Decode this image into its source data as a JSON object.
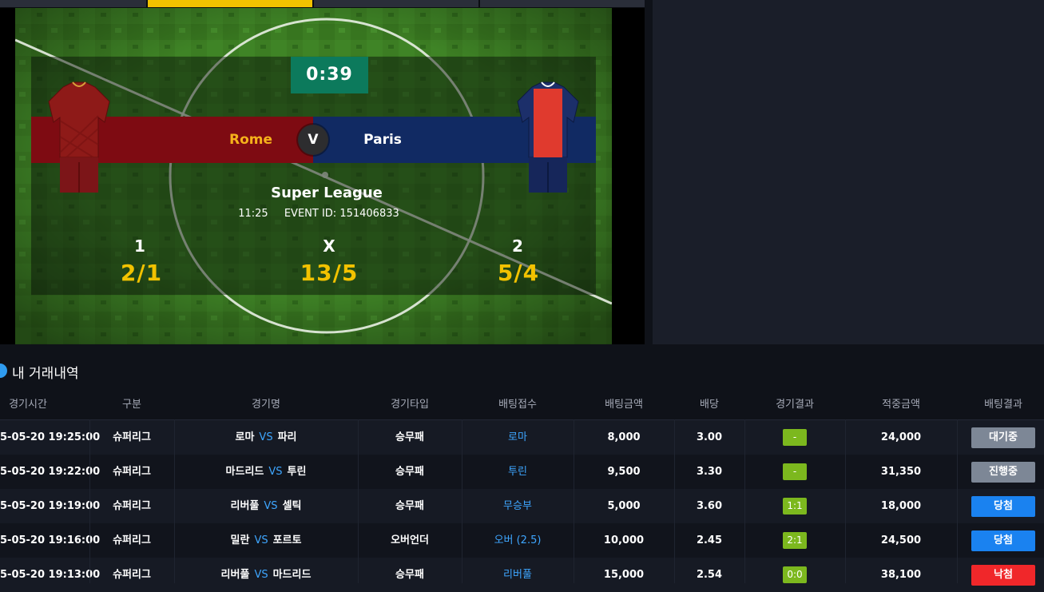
{
  "match": {
    "timer": "0:39",
    "home_team": "Rome",
    "away_team": "Paris",
    "vs": "V",
    "league": "Super League",
    "time": "11:25",
    "event_id": "EVENT ID:  151406833",
    "odds": [
      {
        "label": "1",
        "value": "2/1"
      },
      {
        "label": "X",
        "value": "13/5"
      },
      {
        "label": "2",
        "value": "5/4"
      }
    ],
    "colors": {
      "home": "#7e0b12",
      "away": "#112a63",
      "odds": "#f2c200",
      "timer": "#0c7a5c"
    }
  },
  "history": {
    "title": "내 거래내역",
    "columns": [
      "경기시간",
      "구분",
      "경기명",
      "경기타입",
      "배팅접수",
      "배팅금액",
      "배당",
      "경기결과",
      "적중금액",
      "배팅결과"
    ],
    "rows": [
      {
        "time": "5-05-20 19:25:00",
        "category": "슈퍼리그",
        "home": "로마",
        "away": "파리",
        "vs": "VS",
        "type": "승무패",
        "pick": "로마",
        "amount": "8,000",
        "odds": "3.00",
        "result": "-",
        "payout": "24,000",
        "status": "대기중",
        "status_color": "#7d8796"
      },
      {
        "time": "5-05-20 19:22:00",
        "category": "슈퍼리그",
        "home": "마드리드",
        "away": "투린",
        "vs": "VS",
        "type": "승무패",
        "pick": "투린",
        "amount": "9,500",
        "odds": "3.30",
        "result": "-",
        "payout": "31,350",
        "status": "진행중",
        "status_color": "#7d8796"
      },
      {
        "time": "5-05-20 19:19:00",
        "category": "슈퍼리그",
        "home": "리버풀",
        "away": "셀틱",
        "vs": "VS",
        "type": "승무패",
        "pick": "무승부",
        "amount": "5,000",
        "odds": "3.60",
        "result": "1:1",
        "payout": "18,000",
        "status": "당첨",
        "status_color": "#1a82f0"
      },
      {
        "time": "5-05-20 19:16:00",
        "category": "슈퍼리그",
        "home": "밀란",
        "away": "포르토",
        "vs": "VS",
        "type": "오버언더",
        "pick": "오버 (2.5)",
        "amount": "10,000",
        "odds": "2.45",
        "result": "2:1",
        "payout": "24,500",
        "status": "당첨",
        "status_color": "#1a82f0"
      },
      {
        "time": "5-05-20 19:13:00",
        "category": "슈퍼리그",
        "home": "리버풀",
        "away": "마드리드",
        "vs": "VS",
        "type": "승무패",
        "pick": "리버풀",
        "amount": "15,000",
        "odds": "2.54",
        "result": "0:0",
        "payout": "38,100",
        "status": "낙첨",
        "status_color": "#f0272a"
      }
    ]
  }
}
